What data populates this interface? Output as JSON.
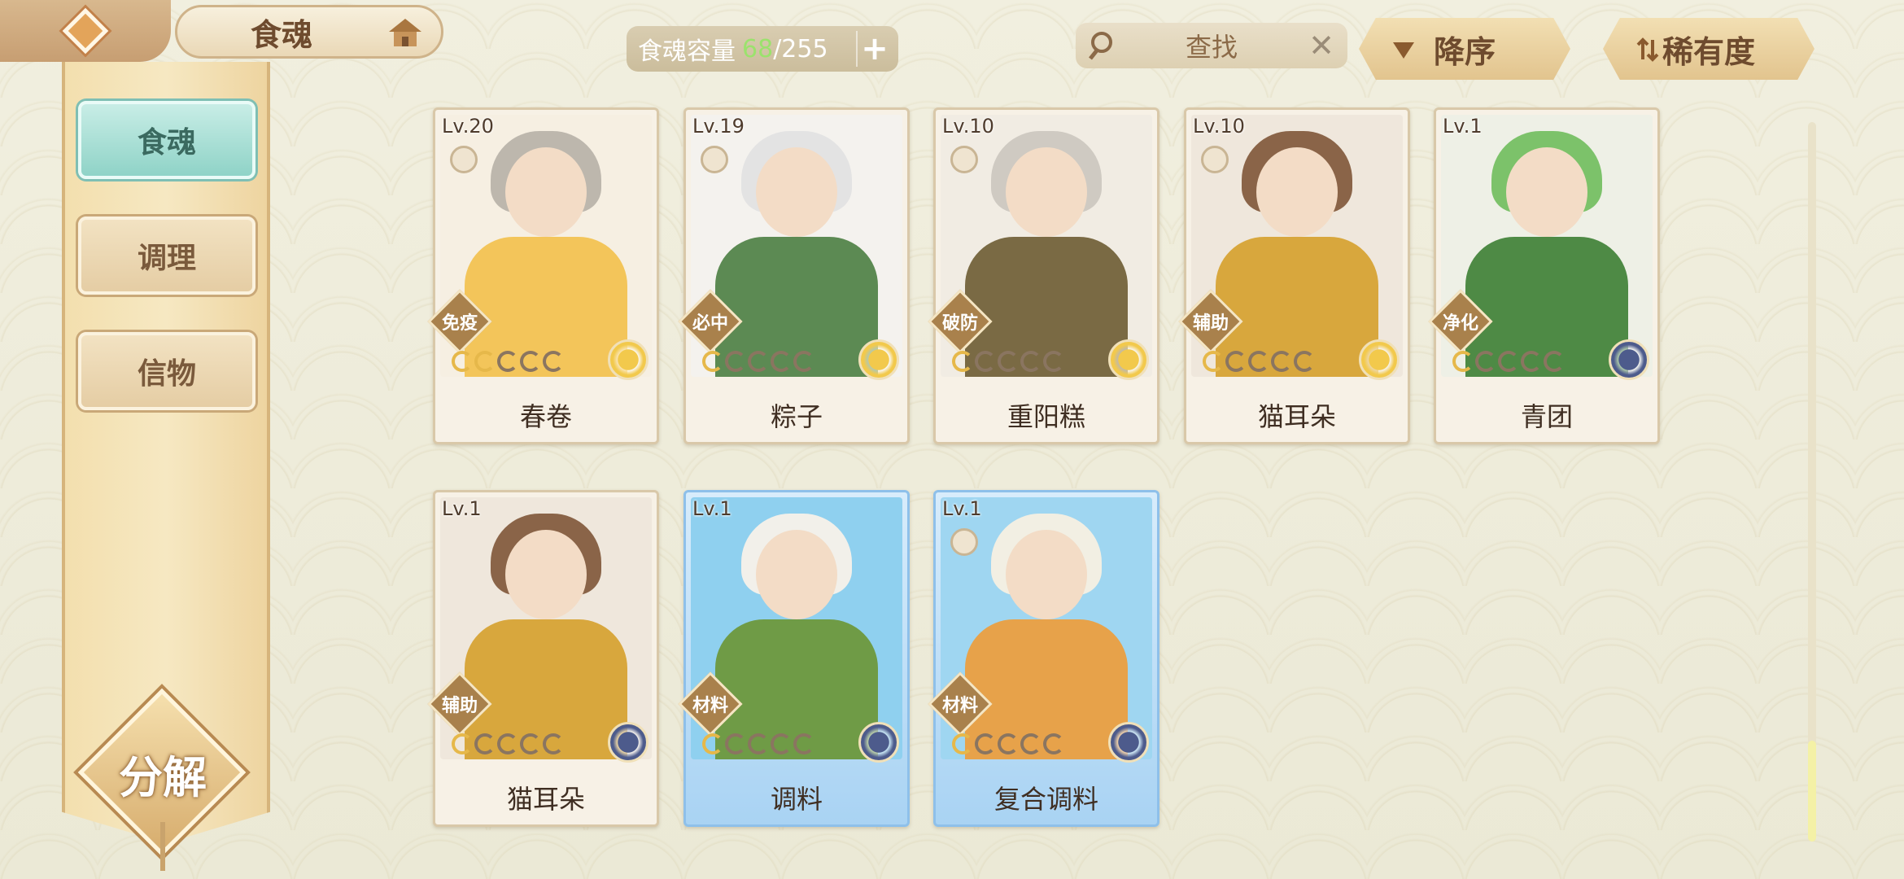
{
  "header": {
    "title": "食魂",
    "capacity_label": "食魂容量",
    "capacity_current": "68",
    "capacity_total": "/255",
    "capacity_plus": "+"
  },
  "search": {
    "placeholder": "查找",
    "clear": "✕"
  },
  "sort": {
    "order_label": "降序",
    "rarity_label": "稀有度"
  },
  "sidebar": {
    "tabs": [
      {
        "label": "食魂",
        "active": true
      },
      {
        "label": "调理",
        "active": false
      },
      {
        "label": "信物",
        "active": false
      }
    ],
    "decompose_label": "分解"
  },
  "colors": {
    "accent_teal": "#8fd3c7",
    "gold": "#e6b84a",
    "bg": "#f1efdf"
  },
  "cards": [
    {
      "level": "Lv.20",
      "role": "免疫",
      "name": "春卷",
      "stars": 2,
      "emblem": "gold-flower-icon",
      "hair": "#bdb7ad",
      "body": "#f3c55a",
      "bg": "#f6efe2"
    },
    {
      "level": "Lv.19",
      "role": "必中",
      "name": "粽子",
      "stars": 1,
      "emblem": "gold-flower-icon",
      "hair": "#e3e3e3",
      "body": "#5c8a53",
      "bg": "#f4f2ee"
    },
    {
      "level": "Lv.10",
      "role": "破防",
      "name": "重阳糕",
      "stars": 1,
      "emblem": "gold-flower-icon",
      "hair": "#cfcac2",
      "body": "#7a6a44",
      "bg": "#f1ece3"
    },
    {
      "level": "Lv.10",
      "role": "辅助",
      "name": "猫耳朵",
      "stars": 1,
      "emblem": "gold-flower-icon",
      "hair": "#8a6448",
      "body": "#d8a73d",
      "bg": "#efe7dc"
    },
    {
      "level": "Lv.1",
      "role": "净化",
      "name": "青团",
      "stars": 1,
      "emblem": "blue-flower-icon",
      "hair": "#7cc26a",
      "body": "#4e8a45",
      "bg": "#eef0e6"
    },
    {
      "level": "Lv.1",
      "role": "辅助",
      "name": "猫耳朵",
      "stars": 1,
      "emblem": "blue-flower-icon",
      "hair": "#8a6448",
      "body": "#d8a73d",
      "bg": "#efe7dc"
    },
    {
      "level": "Lv.1",
      "role": "材料",
      "name": "调料",
      "stars": 1,
      "emblem": "blue-flower-icon",
      "hair": "#f2f0ea",
      "body": "#6f9b46",
      "bg": "#8fd0ef"
    },
    {
      "level": "Lv.1",
      "role": "材料",
      "name": "复合调料",
      "stars": 1,
      "emblem": "blue-flower-icon",
      "hair": "#f2efe3",
      "body": "#e7a24a",
      "bg": "#9fd6f1"
    }
  ]
}
